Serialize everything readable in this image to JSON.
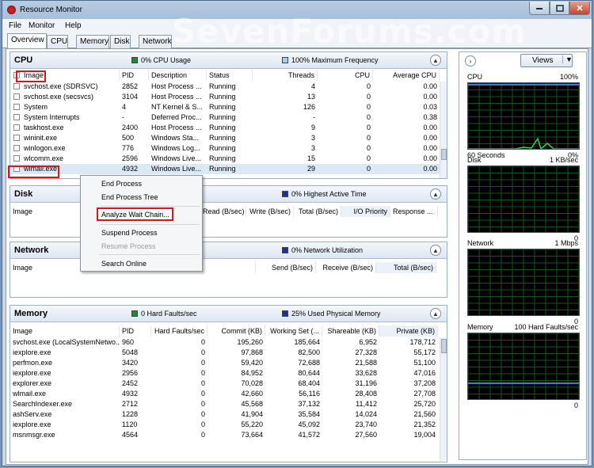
{
  "window": {
    "title": "Resource Monitor",
    "watermark": "SevenForums.com"
  },
  "menu": [
    "File",
    "Monitor",
    "Help"
  ],
  "tabs": [
    "Overview",
    "CPU",
    "Memory",
    "Disk",
    "Network"
  ],
  "cpu": {
    "title": "CPU",
    "usage": "0% CPU Usage",
    "freq": "100% Maximum Frequency",
    "usage_color": "#1f8a2b",
    "freq_color": "#a9cff0",
    "columns": [
      "Image",
      "PID",
      "Description",
      "Status",
      "Threads",
      "CPU",
      "Average CPU"
    ],
    "rows": [
      [
        "svchost.exe (SDRSVC)",
        "2852",
        "Host Process ...",
        "Running",
        "4",
        "0",
        "0.00"
      ],
      [
        "svchost.exe (secsvcs)",
        "3104",
        "Host Process ...",
        "Running",
        "13",
        "0",
        "0.00"
      ],
      [
        "System",
        "4",
        "NT Kernel & S...",
        "Running",
        "126",
        "0",
        "0.03"
      ],
      [
        "System Interrupts",
        "-",
        "Deferred Proc...",
        "Running",
        "-",
        "0",
        "0.38"
      ],
      [
        "taskhost.exe",
        "2400",
        "Host Process ...",
        "Running",
        "9",
        "0",
        "0.00"
      ],
      [
        "wininit.exe",
        "500",
        "Windows Sta...",
        "Running",
        "3",
        "0",
        "0.00"
      ],
      [
        "winlogon.exe",
        "776",
        "Windows Log...",
        "Running",
        "3",
        "0",
        "0.00"
      ],
      [
        "wlcomm.exe",
        "2596",
        "Windows Live...",
        "Running",
        "15",
        "0",
        "0.00"
      ],
      [
        "wlmail.exe",
        "4932",
        "Windows Live...",
        "Running",
        "29",
        "0",
        "0.00"
      ]
    ]
  },
  "disk": {
    "title": "Disk",
    "legend": "0% Highest Active Time",
    "legend_color": "#1d2fa8",
    "columns": [
      "Image",
      "Read (B/sec)",
      "Write (B/sec)",
      "Total (B/sec)",
      "I/O Priority",
      "Response ..."
    ]
  },
  "network": {
    "title": "Network",
    "legend": "0% Network Utilization",
    "legend_color": "#1d2fa8",
    "columns": [
      "Image",
      "Send (B/sec)",
      "Receive (B/sec)",
      "Total (B/sec)"
    ]
  },
  "memory": {
    "title": "Memory",
    "faults": "0 Hard Faults/sec",
    "used": "25% Used Physical Memory",
    "faults_color": "#1f8a2b",
    "used_color": "#1d2fa8",
    "columns": [
      "Image",
      "PID",
      "Hard Faults/sec",
      "Commit (KB)",
      "Working Set (...",
      "Shareable (KB)",
      "Private (KB)"
    ],
    "rows": [
      [
        "svchost.exe (LocalSystemNetwo...",
        "960",
        "0",
        "195,260",
        "185,664",
        "6,952",
        "178,712"
      ],
      [
        "iexplore.exe",
        "5048",
        "0",
        "97,868",
        "82,500",
        "27,328",
        "55,172"
      ],
      [
        "perfmon.exe",
        "3420",
        "0",
        "59,420",
        "72,688",
        "21,588",
        "51,100"
      ],
      [
        "iexplore.exe",
        "2956",
        "0",
        "84,952",
        "80,644",
        "33,628",
        "47,016"
      ],
      [
        "explorer.exe",
        "2452",
        "0",
        "70,028",
        "68,404",
        "31,196",
        "37,208"
      ],
      [
        "wlmail.exe",
        "4932",
        "0",
        "42,660",
        "56,116",
        "28,408",
        "27,708"
      ],
      [
        "SearchIndexer.exe",
        "2712",
        "0",
        "45,568",
        "37,132",
        "11,412",
        "25,720"
      ],
      [
        "ashServ.exe",
        "1228",
        "0",
        "41,904",
        "35,584",
        "14,024",
        "21,560"
      ],
      [
        "iexplore.exe",
        "1120",
        "0",
        "55,220",
        "45,092",
        "23,740",
        "21,352"
      ],
      [
        "msnmsgr.exe",
        "4564",
        "0",
        "73,664",
        "41,572",
        "27,560",
        "19,004"
      ]
    ]
  },
  "context_menu": {
    "items": [
      "End Process",
      "End Process Tree",
      "Analyze Wait Chain...",
      "Suspend Process",
      "Resume Process",
      "Search Online"
    ]
  },
  "right_panel": {
    "views_label": "Views",
    "graphs": [
      {
        "name": "CPU",
        "value": "100%",
        "foot_left": "60 Seconds",
        "foot_right": "0%"
      },
      {
        "name": "Disk",
        "value": "1 KB/sec",
        "foot_right": "0"
      },
      {
        "name": "Network",
        "value": "1 Mbps",
        "foot_right": "0"
      },
      {
        "name": "Memory",
        "value": "100 Hard Faults/sec",
        "foot_right": "0"
      }
    ]
  }
}
